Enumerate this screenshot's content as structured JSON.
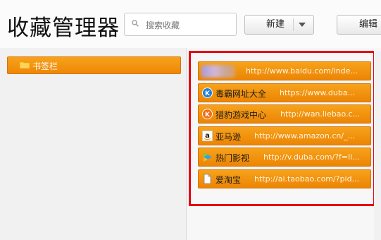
{
  "header": {
    "title": "收藏管理器",
    "search_placeholder": "搜索收藏",
    "new_label": "新建",
    "edit_label": "编辑"
  },
  "sidebar": {
    "folder_label": "书签栏"
  },
  "bookmarks": [
    {
      "name": "",
      "url": "http://www.baidu.com/inde...",
      "icon": "blurred-favicon"
    },
    {
      "name": "毒霸网址大全",
      "url": "https://www.duba...",
      "icon": "kingsoft-k-icon"
    },
    {
      "name": "猎豹游戏中心",
      "url": "http://wan.liebao.c...",
      "icon": "liebao-icon"
    },
    {
      "name": "亚马逊",
      "url": "http://www.amazon.cn/_...",
      "icon": "amazon-icon"
    },
    {
      "name": "热门影视",
      "url": "http://v.duba.com/?f=li...",
      "icon": "video-play-icon"
    },
    {
      "name": "爱淘宝",
      "url": "http://ai.taobao.com/?pid...",
      "icon": "page-icon"
    }
  ],
  "colors": {
    "accent_orange": "#f39a12",
    "highlight_red": "#e60012"
  }
}
